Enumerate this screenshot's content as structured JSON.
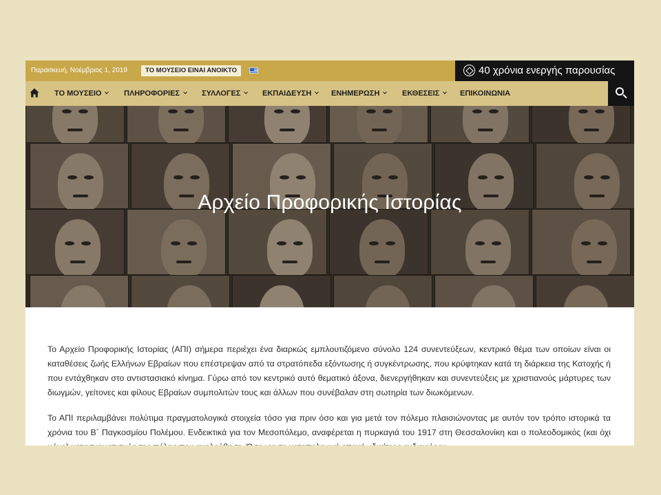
{
  "topbar": {
    "date": "Παρασκευή, Νοέμβριος 1, 2019",
    "museum_status": "ΤΟ ΜΟΥΣΕΙΟ ΕΙΝΑΙ ΑΝΟΙΚΤΟ",
    "language_flag": "greek-flag-icon",
    "anniversary": "40 χρόνια ενεργής παρουσίας"
  },
  "nav": {
    "home_icon": "home-icon",
    "items": [
      {
        "label": "ΤΟ ΜΟΥΣΕΙΟ",
        "dropdown": true
      },
      {
        "label": "ΠΛΗΡΟΦΟΡΙΕΣ",
        "dropdown": true
      },
      {
        "label": "ΣΥΛΛΟΓΕΣ",
        "dropdown": true
      },
      {
        "label": "ΕΚΠΑΙΔΕΥΣΗ",
        "dropdown": true
      },
      {
        "label": "ΕΝΗΜΕΡΩΣΗ",
        "dropdown": true
      },
      {
        "label": "ΕΚΘΕΣΕΙΣ",
        "dropdown": true
      },
      {
        "label": "ΕΠΙΚΟΙΝΩΝΙΑ",
        "dropdown": false
      }
    ],
    "search_icon": "search-icon"
  },
  "hero": {
    "title": "Αρχείο Προφορικής Ιστορίας"
  },
  "content": {
    "paragraphs": [
      "Το Αρχείο Προφορικής Ιστορίας (ΑΠΙ) σήμερα περιέχει ένα διαρκώς εμπλουτιζόμενο σύνολο 124 συνεντεύξεων, κεντρικό θέμα των οποίων είναι οι καταθέσεις ζωής Ελλήνων Εβραίων που επέστρεψαν από τα στρατόπεδα εξόντωσης ή συγκέντρωσης, που κρύφτηκαν κατά τη διάρκεια της Κατοχής ή που εντάχθηκαν στο αντιστασιακό κίνημα. Γύρω από τον κεντρικό αυτό θεματικό άξονα, διενεργήθηκαν και συνεντεύξεις με χριστιανούς μάρτυρες των διωγμών, γείτονες και φίλους Εβραίων συμπολιτών τους και άλλων που συνέβαλαν στη σωτηρία των διωκόμενων.",
      "Το ΑΠΙ περιλαμβάνει πολύτιμα πραγματολογικά στοιχεία τόσο για πριν όσο και για μετά τον πόλεμο πλαισιώνοντας με αυτόν τον τρόπο ιστορικά τα χρόνια του Β΄ Παγκοσμίου Πολέμου. Ενδεικτικά για τον Μεσοπόλεμο, αναφέρεται η πυρκαγιά του 1917 στη Θεσσαλονίκη και ο πολεοδομικός (και όχι μόνο) μετασχηματισμός της πόλης που ακολούθησε. Όσο για τη μεταπολεμική εποχή, ιδιαίτερο ενδιαφέρον"
    ]
  }
}
